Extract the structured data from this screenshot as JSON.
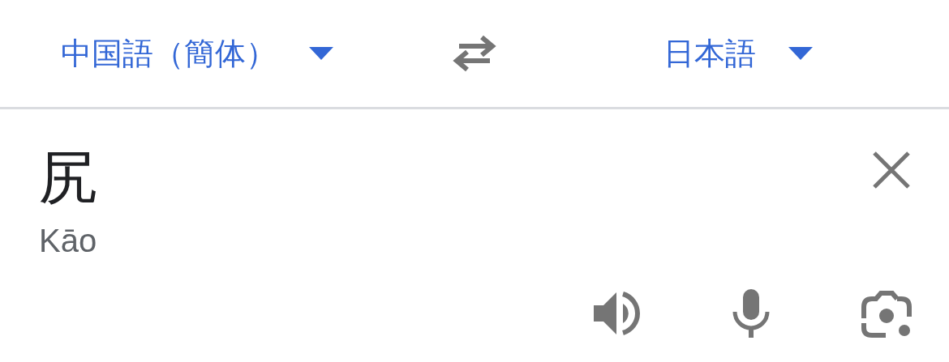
{
  "source_language": {
    "label": "中国語（簡体）"
  },
  "target_language": {
    "label": "日本語"
  },
  "input": {
    "text": "尻",
    "romanization": "Kāo"
  }
}
